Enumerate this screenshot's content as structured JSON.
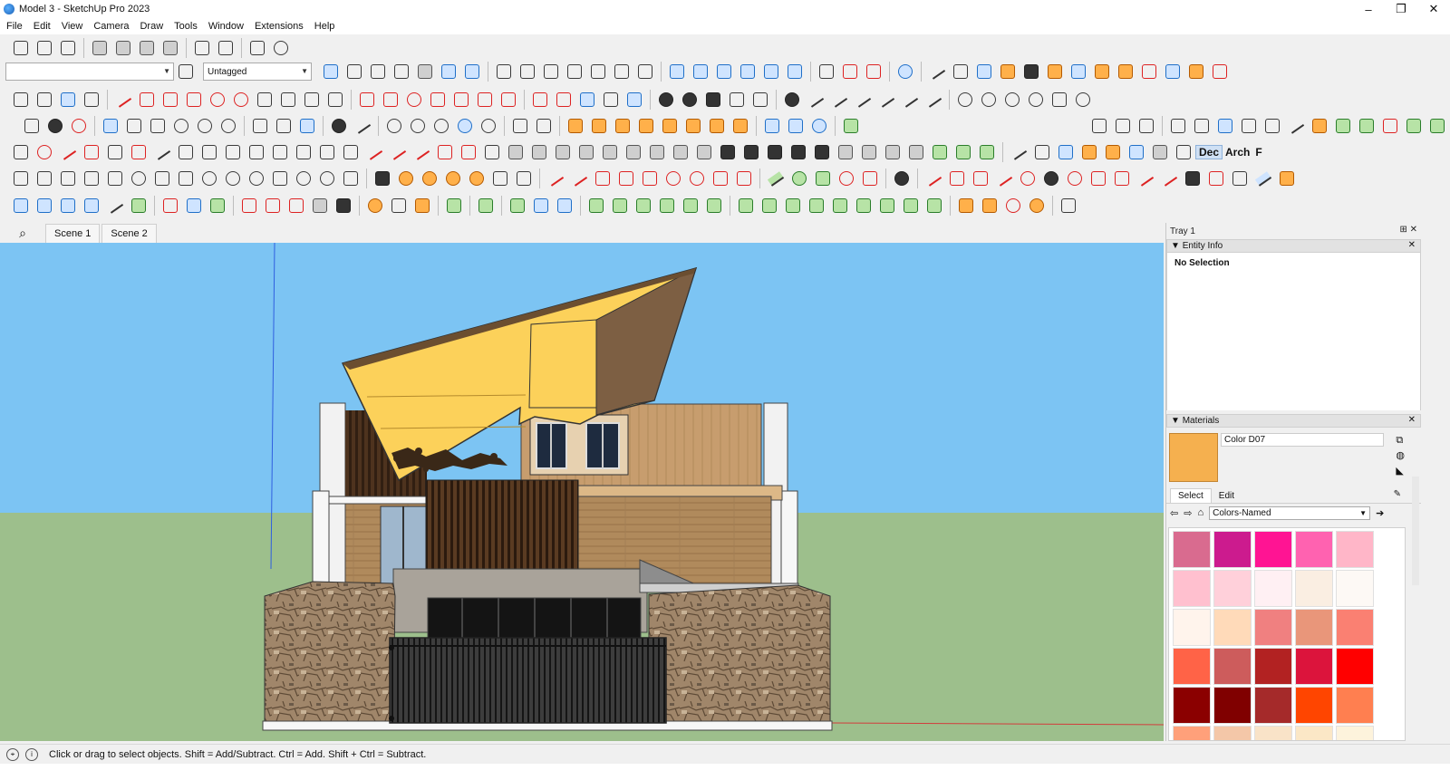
{
  "window": {
    "title": "Model 3 - SketchUp Pro 2023",
    "controls": [
      "–",
      "❐",
      "✕"
    ]
  },
  "menu": [
    "File",
    "Edit",
    "View",
    "Camera",
    "Draw",
    "Tools",
    "Window",
    "Extensions",
    "Help"
  ],
  "toolbar": {
    "tag_value": "Untagged",
    "text_tools": [
      "Dec",
      "Arch",
      "F"
    ]
  },
  "scenes": {
    "search_icon": "⌕",
    "tabs": [
      "Scene 1",
      "Scene 2"
    ]
  },
  "tray": {
    "title": "Tray 1",
    "entity_info": {
      "title": "Entity Info",
      "selection": "No Selection"
    },
    "materials": {
      "title": "Materials",
      "color_name": "Color D07",
      "swatch_color": "#f5b04f",
      "tabs": [
        "Select",
        "Edit"
      ],
      "collection": "Colors-Named",
      "colors": [
        "#d96b8f",
        "#cc1b8e",
        "#ff1493",
        "#ff62b0",
        "#ffb6c8",
        "#ffc0cf",
        "#ffd0da",
        "#fff0f3",
        "#faeee2",
        "#fdf9f5",
        "#fff4ec",
        "#ffdab9",
        "#f08080",
        "#e9967a",
        "#fa8072",
        "#ff6347",
        "#cd5c5c",
        "#b22222",
        "#dc143c",
        "#ff0000",
        "#8b0000",
        "#800000",
        "#a52a2a",
        "#ff4500",
        "#ff7f50",
        "#ffa07a",
        "#f4c7a8",
        "#f9e3c8",
        "#fbe7c6",
        "#fdf3dc"
      ]
    }
  },
  "status": {
    "text": "Click or drag to select objects. Shift = Add/Subtract. Ctrl = Add. Shift + Ctrl = Subtract."
  },
  "colors": {
    "sky": "#7cc4f3",
    "ground": "#9dbf8c",
    "roof": "#fcd15a",
    "wood": "#b08a5c"
  }
}
